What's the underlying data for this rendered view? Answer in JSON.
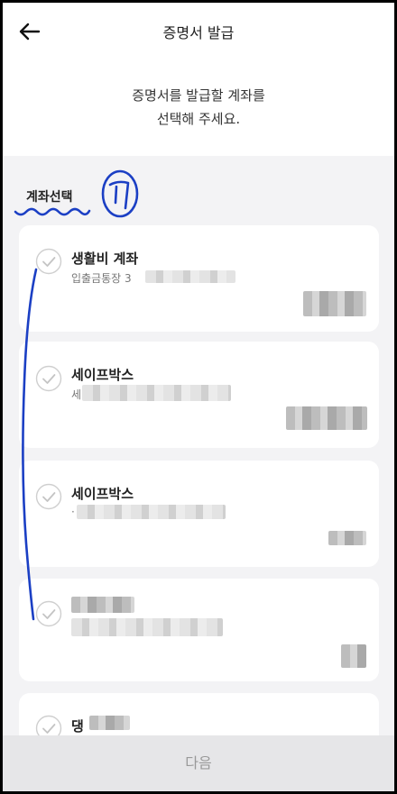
{
  "header": {
    "title": "증명서 발급",
    "back_icon": "arrow-left-icon"
  },
  "instruction": {
    "line1": "증명서를 발급할 계좌를",
    "line2": "선택해 주세요."
  },
  "section": {
    "label": "계좌선택"
  },
  "accounts": [
    {
      "name": "생활비 계좌",
      "subtitle": "입출금통장 3"
    },
    {
      "name": "세이프박스",
      "subtitle": "세"
    },
    {
      "name": "세이프박스",
      "subtitle": "·"
    },
    {
      "name": "",
      "subtitle": ""
    },
    {
      "name": "댕",
      "subtitle": ""
    }
  ],
  "footer": {
    "next_label": "다음"
  },
  "colors": {
    "annotation_ink": "#1b3fc4",
    "check_gray": "#c9c9c9",
    "footer_bg": "#e6e6e8"
  }
}
